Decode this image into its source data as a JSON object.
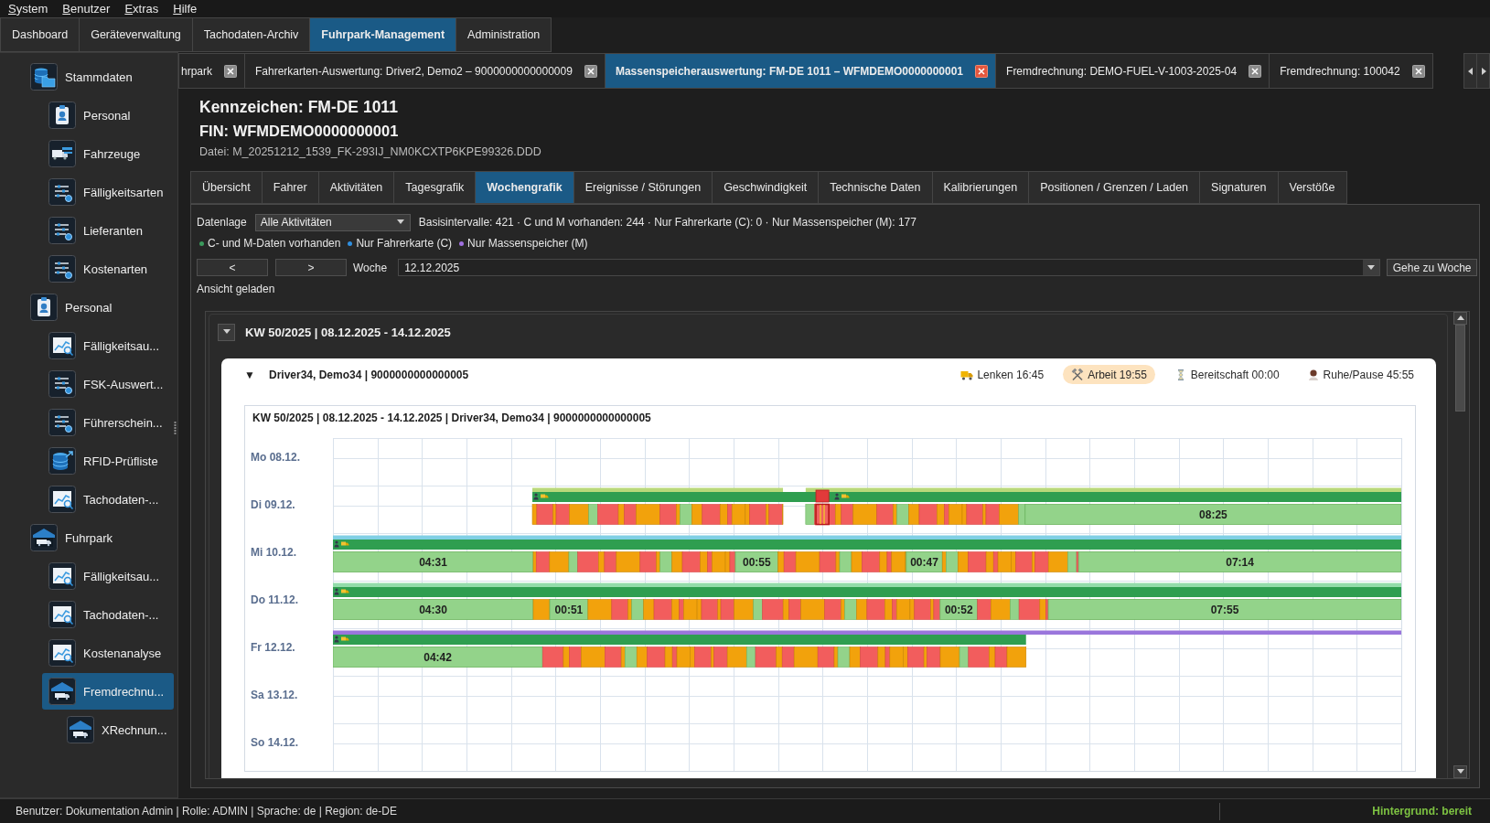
{
  "menu": [
    "System",
    "Benutzer",
    "Extras",
    "Hilfe"
  ],
  "main_tabs": [
    {
      "label": "Dashboard",
      "selected": false
    },
    {
      "label": "Geräteverwaltung",
      "selected": false
    },
    {
      "label": "Tachodaten-Archiv",
      "selected": false
    },
    {
      "label": "Fuhrpark-Management",
      "selected": true
    },
    {
      "label": "Administration",
      "selected": false
    }
  ],
  "sidebar": {
    "items": [
      {
        "label": "Stammdaten",
        "kind": "folder",
        "selected": false,
        "children": [
          {
            "label": "Personal",
            "kind": "badge",
            "selected": false
          },
          {
            "label": "Fahrzeuge",
            "kind": "vehicles",
            "selected": false
          },
          {
            "label": "Fälligkeitsarten",
            "kind": "list",
            "selected": false
          },
          {
            "label": "Lieferanten",
            "kind": "list",
            "selected": false
          },
          {
            "label": "Kostenarten",
            "kind": "list",
            "selected": false
          }
        ]
      },
      {
        "label": "Personal",
        "kind": "badge",
        "selected": false,
        "children": [
          {
            "label": "Fälligkeitsau...",
            "kind": "chart",
            "selected": false
          },
          {
            "label": "FSK-Auswert...",
            "kind": "list",
            "selected": false
          },
          {
            "label": "Führerschein...",
            "kind": "list",
            "selected": false
          },
          {
            "label": "RFID-Prüfliste",
            "kind": "database",
            "selected": false
          },
          {
            "label": "Tachodaten-...",
            "kind": "chart",
            "selected": false
          }
        ]
      },
      {
        "label": "Fuhrpark",
        "kind": "garage",
        "selected": false,
        "children": [
          {
            "label": "Fälligkeitsau...",
            "kind": "chart",
            "selected": false
          },
          {
            "label": "Tachodaten-...",
            "kind": "chart",
            "selected": false
          },
          {
            "label": "Kostenanalyse",
            "kind": "chart",
            "selected": false
          },
          {
            "label": "Fremdrechnu...",
            "kind": "garage",
            "selected": true,
            "children": [
              {
                "label": "XRechnun...",
                "kind": "garage",
                "selected": false
              }
            ]
          }
        ]
      }
    ]
  },
  "document_tabs": [
    {
      "label": "hrpark",
      "selected": false
    },
    {
      "label": "Fahrerkarten-Auswertung: Driver2, Demo2 – 9000000000000009",
      "selected": false
    },
    {
      "label": "Massenspeicherauswertung: FM-DE 1011 – WFMDEMO0000000001",
      "selected": true
    },
    {
      "label": "Fremdrechnung: DEMO-FUEL-V-1003-2025-04",
      "selected": false
    },
    {
      "label": "Fremdrechnung: 100042",
      "selected": false
    }
  ],
  "header": {
    "title": "Kennzeichen: FM-DE 1011",
    "vin": "FIN: WFMDEMO0000000001",
    "file": "Datei: M_20251212_1539_FK-293IJ_NM0KCXTP6KPE99326.DDD"
  },
  "view_tabs": [
    {
      "label": "Übersicht",
      "selected": false
    },
    {
      "label": "Fahrer",
      "selected": false
    },
    {
      "label": "Aktivitäten",
      "selected": false
    },
    {
      "label": "Tagesgrafik",
      "selected": false
    },
    {
      "label": "Wochengrafik",
      "selected": true
    },
    {
      "label": "Ereignisse / Störungen",
      "selected": false
    },
    {
      "label": "Geschwindigkeit",
      "selected": false
    },
    {
      "label": "Technische Daten",
      "selected": false
    },
    {
      "label": "Kalibrierungen",
      "selected": false
    },
    {
      "label": "Positionen / Grenzen / Laden",
      "selected": false
    },
    {
      "label": "Signaturen",
      "selected": false
    },
    {
      "label": "Verstöße",
      "selected": false
    }
  ],
  "filter": {
    "label": "Datenlage",
    "value": "Alle Aktivitäten",
    "summary": "Basisintervalle: 421 · C und M vorhanden: 244 · Nur Fahrerkarte (C): 0 · Nur Massenspeicher (M): 177"
  },
  "legend": [
    {
      "label": "C- und M-Daten vorhanden",
      "color": "#3a9a5c"
    },
    {
      "label": "Nur Fahrerkarte (C)",
      "color": "#2f8fe0"
    },
    {
      "label": "Nur Massenspeicher (M)",
      "color": "#a070e0"
    }
  ],
  "week_nav": {
    "prev": "<",
    "next": ">",
    "label": "Woche",
    "value": "12.12.2025",
    "go": "Gehe zu Woche"
  },
  "status_message": "Ansicht geladen",
  "week_section": {
    "title": "KW 50/2025 | 08.12.2025 - 14.12.2025",
    "expanded": true,
    "driver_card": {
      "toggle": "▼",
      "title": "Driver34, Demo34 | 9000000000000005",
      "stats": [
        {
          "kind": "driving",
          "label": "Lenken 16:45",
          "selected": false
        },
        {
          "kind": "work",
          "label": "Arbeit 19:55",
          "selected": true
        },
        {
          "kind": "standby",
          "label": "Bereitschaft 00:00",
          "selected": false
        },
        {
          "kind": "rest",
          "label": "Ruhe/Pause 45:55",
          "selected": false
        }
      ],
      "chart": {
        "title": "KW 50/2025 | 08.12.2025 - 14.12.2025 | Driver34, Demo34 | 9000000000000005",
        "days": [
          {
            "label": "Mo 08.12."
          },
          {
            "label": "Di 09.12.",
            "color": "#b9d97a",
            "durations": [
              "08:25"
            ]
          },
          {
            "label": "Mi 10.12.",
            "color": "#80cfe4",
            "durations": [
              "04:31",
              "00:55",
              "00:47",
              "07:14"
            ]
          },
          {
            "label": "Do 11.12.",
            "color": "#93dcaa",
            "durations": [
              "04:30",
              "00:51",
              "00:52",
              "07:55"
            ]
          },
          {
            "label": "Fr 12.12.",
            "color": "#9a76dc",
            "durations": [
              "04:42"
            ]
          },
          {
            "label": "Sa 13.12."
          },
          {
            "label": "So 14.12."
          }
        ]
      }
    }
  },
  "status_bar": {
    "left": "Benutzer: Dokumentation Admin | Rolle: ADMIN | Sprache: de | Region: de-DE",
    "right": "Hintergrund: bereit"
  }
}
